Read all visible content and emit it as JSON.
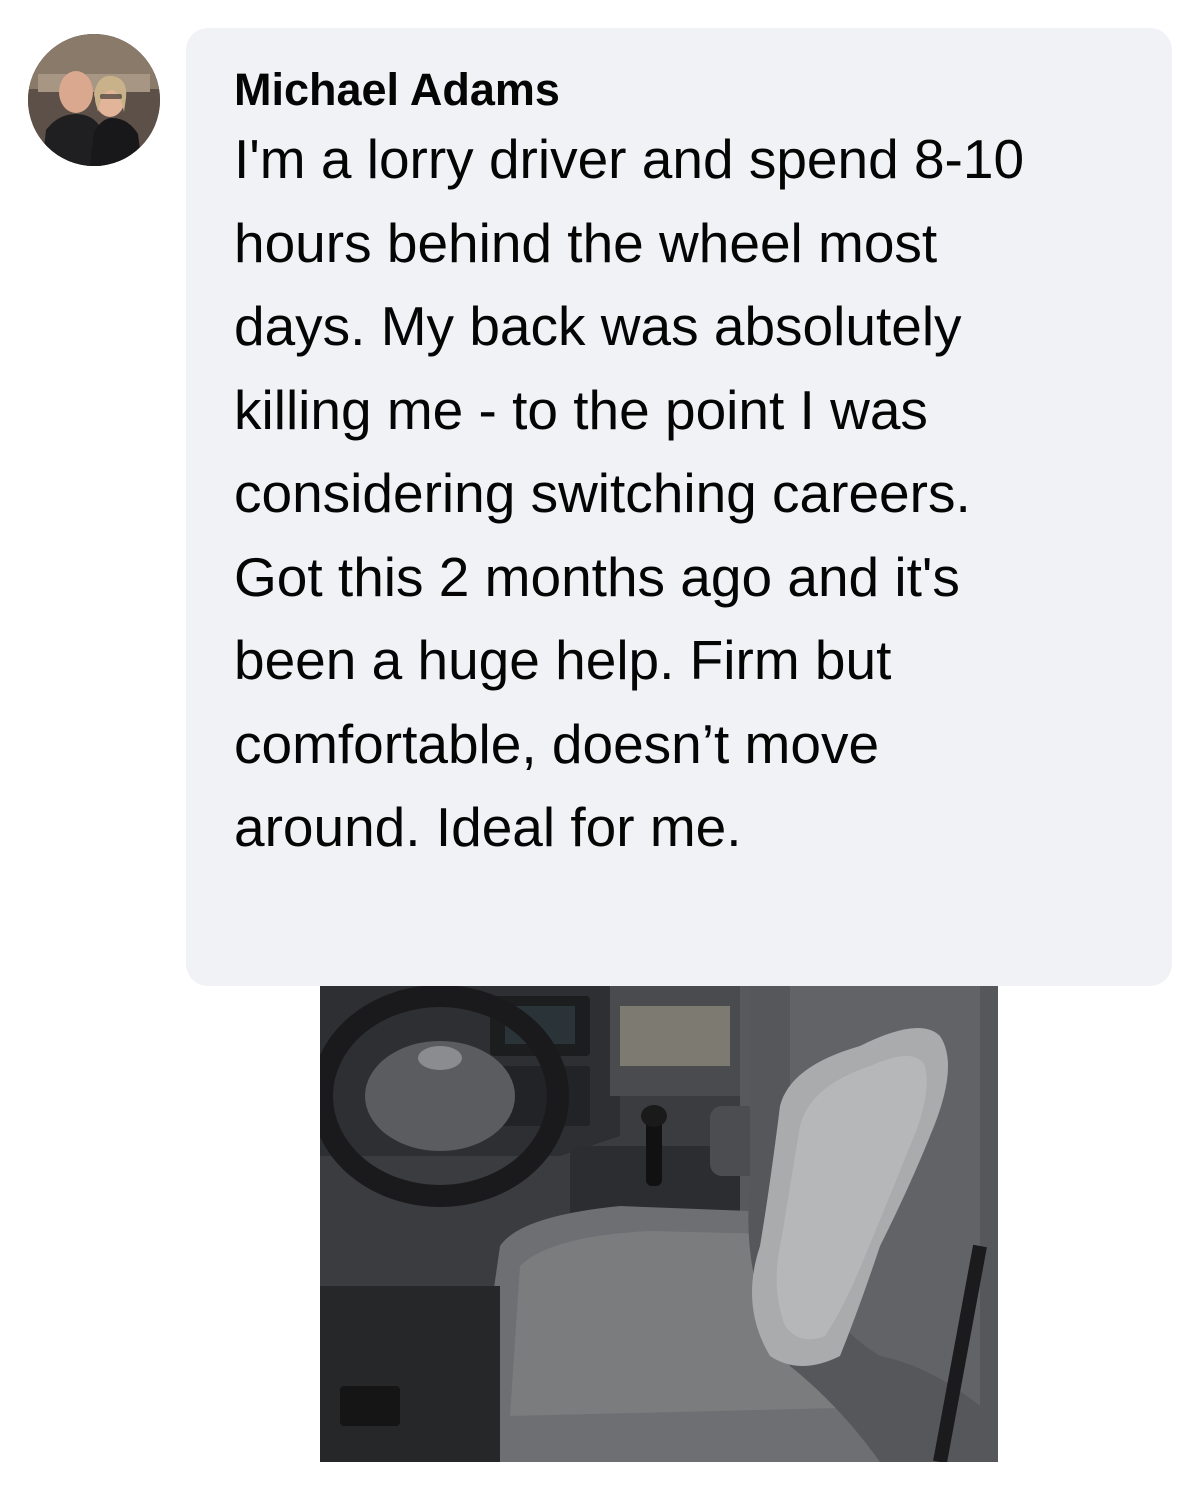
{
  "comment": {
    "author": "Michael Adams",
    "text": "I'm a lorry driver and spend 8-10 hours behind the wheel most days. My back was absolutely killing me - to the point I was considering switching careers. Got this 2 months ago and it's been a huge help. Firm but comfortable, doesn’t move around. Ideal for me."
  },
  "colors": {
    "bubble_background": "#f0f2f5",
    "text": "#050505",
    "page_background": "#ffffff"
  }
}
